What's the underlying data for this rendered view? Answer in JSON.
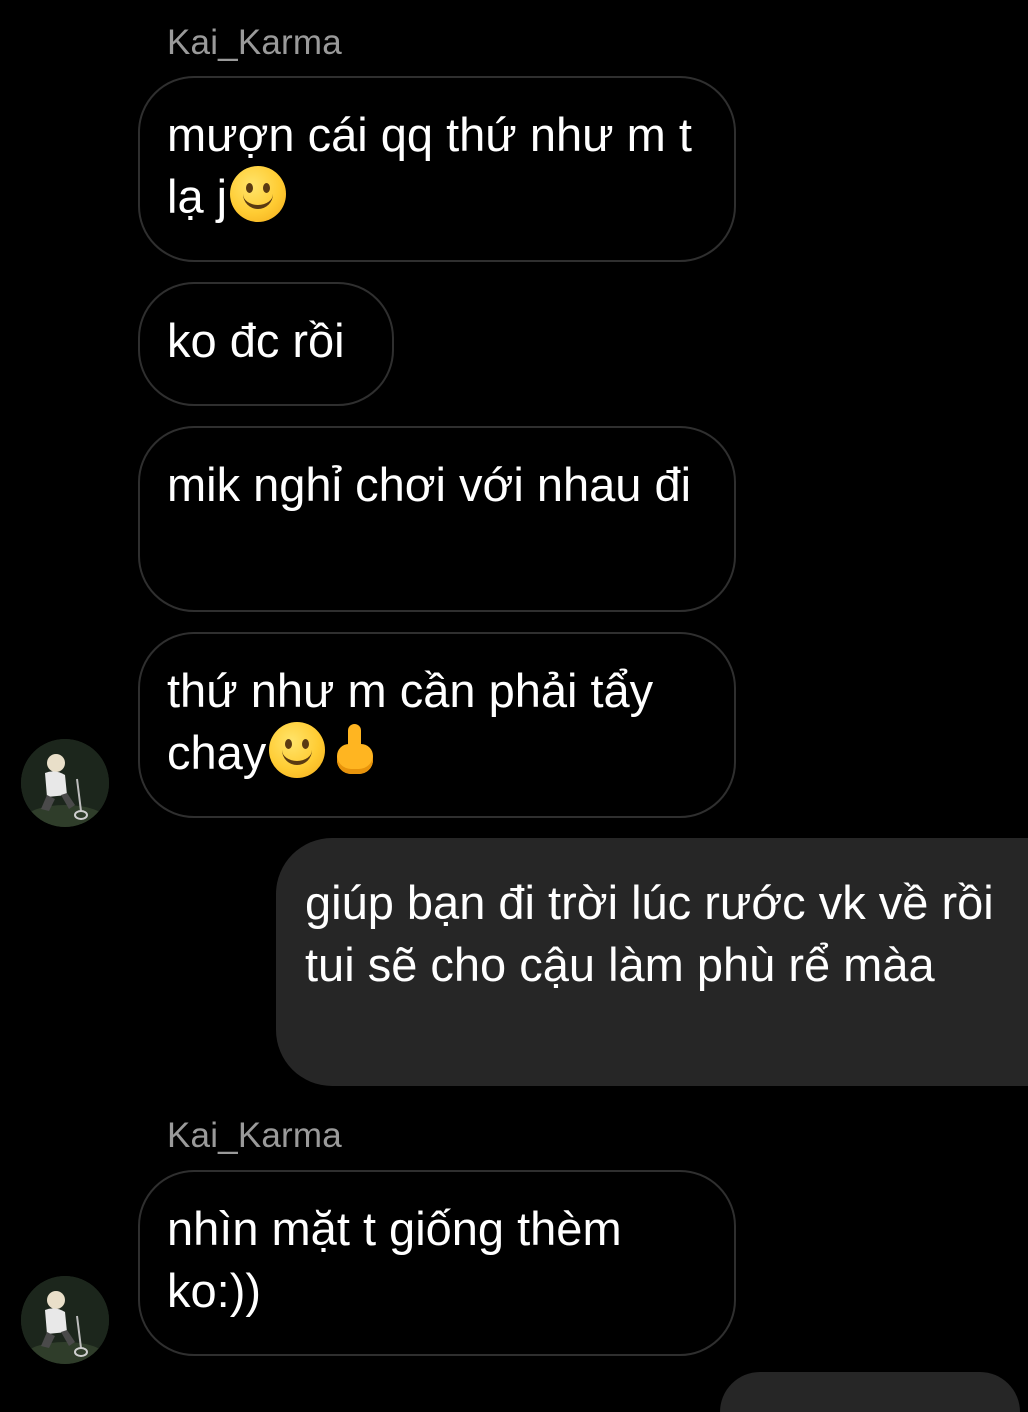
{
  "conversation": {
    "contact_name": "Kai_Karma",
    "messages": [
      {
        "direction": "incoming",
        "text": "mượn cái qq thứ như m t lạ j",
        "emoji": [
          "slightly-smiling-face"
        ]
      },
      {
        "direction": "incoming",
        "text": "ko đc rồi",
        "emoji": []
      },
      {
        "direction": "incoming",
        "text": "mik nghỉ chơi với nhau đi",
        "emoji": []
      },
      {
        "direction": "incoming",
        "text": "thứ như m cần phải tẩy chay",
        "emoji": [
          "slightly-smiling-face",
          "middle-finger"
        ]
      },
      {
        "direction": "outgoing",
        "text": "giúp bạn đi trời lúc rước  vk về rồi tui sẽ cho cậu làm phù rể màa",
        "emoji": []
      },
      {
        "direction": "incoming",
        "text": "nhìn mặt t giống thèm ko:))",
        "emoji": []
      }
    ]
  },
  "theme": {
    "background": "#000000",
    "incoming_border": "#2f2f2f",
    "outgoing_bubble": "#262626",
    "text": "#ffffff",
    "sender_name": "#9a9a9a"
  }
}
